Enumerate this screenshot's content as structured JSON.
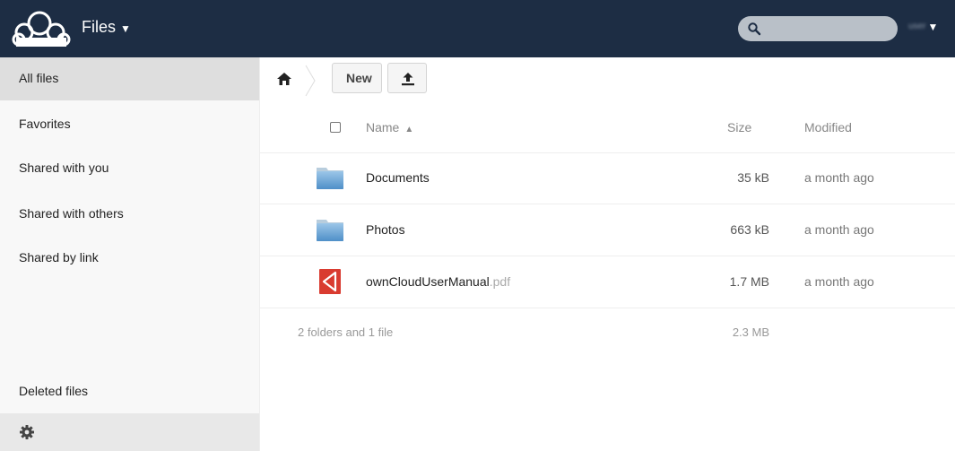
{
  "header": {
    "app_name": "Files",
    "app_caret": "▼",
    "search_placeholder": "",
    "user_name": "user",
    "user_caret": "▼"
  },
  "sidebar": {
    "items": [
      {
        "label": "All files",
        "active": true
      },
      {
        "label": "Favorites"
      },
      {
        "label": "Shared with you"
      },
      {
        "label": "Shared with others"
      },
      {
        "label": "Shared by link"
      }
    ],
    "deleted_label": "Deleted files"
  },
  "controls": {
    "new_label": "New"
  },
  "table": {
    "headers": {
      "name": "Name",
      "sort_indicator": "▲",
      "size": "Size",
      "modified": "Modified"
    },
    "rows": [
      {
        "name": "Documents",
        "ext": "",
        "size": "35 kB",
        "modified": "a month ago",
        "icon": "folder-icon"
      },
      {
        "name": "Photos",
        "ext": "",
        "size": "663 kB",
        "modified": "a month ago",
        "icon": "folder-icon"
      },
      {
        "name": "ownCloudUserManual",
        "ext": ".pdf",
        "size": "1.7 MB",
        "modified": "a month ago",
        "icon": "pdf-icon"
      }
    ],
    "summary": {
      "text": "2 folders and 1 file",
      "size": "2.3 MB"
    }
  },
  "colors": {
    "header_bg": "#1d2d44",
    "sidebar_bg": "#f8f8f8",
    "active_bg": "#dedede"
  }
}
